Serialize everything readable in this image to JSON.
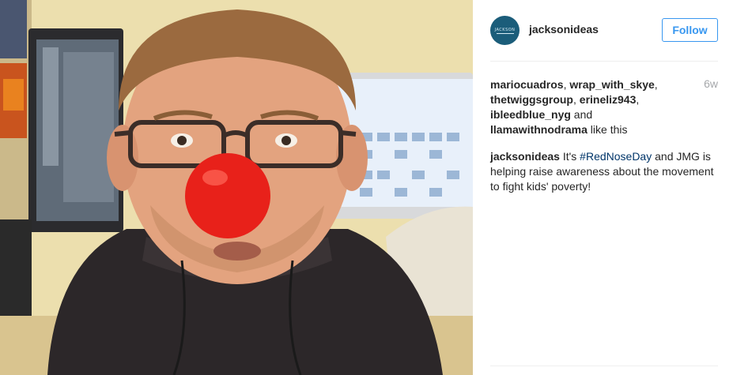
{
  "post": {
    "username": "jacksonideas",
    "follow_label": "Follow",
    "time_ago": "6w",
    "avatar_icon": "jackson-logo-icon",
    "avatar_text": "JACKSON"
  },
  "likes": {
    "users": [
      "mariocuadros",
      "wrap_with_skye",
      "thetwiggsgroup",
      "erineliz943",
      "ibleedblue_nyg",
      "llamawithnodrama"
    ],
    "sep1": ", ",
    "sep_and": " and",
    "suffix": " like this"
  },
  "caption": {
    "author": "jacksonideas",
    "text_before": " It's ",
    "hashtag": "#RedNoseDay",
    "text_after": " and JMG is helping raise awareness about the movement to fight kids' poverty!"
  },
  "photo": {
    "subject": "man-wearing-red-clown-nose"
  },
  "colors": {
    "link_blue": "#3897f0",
    "hashtag": "#003569",
    "time": "#a5a7aa"
  }
}
